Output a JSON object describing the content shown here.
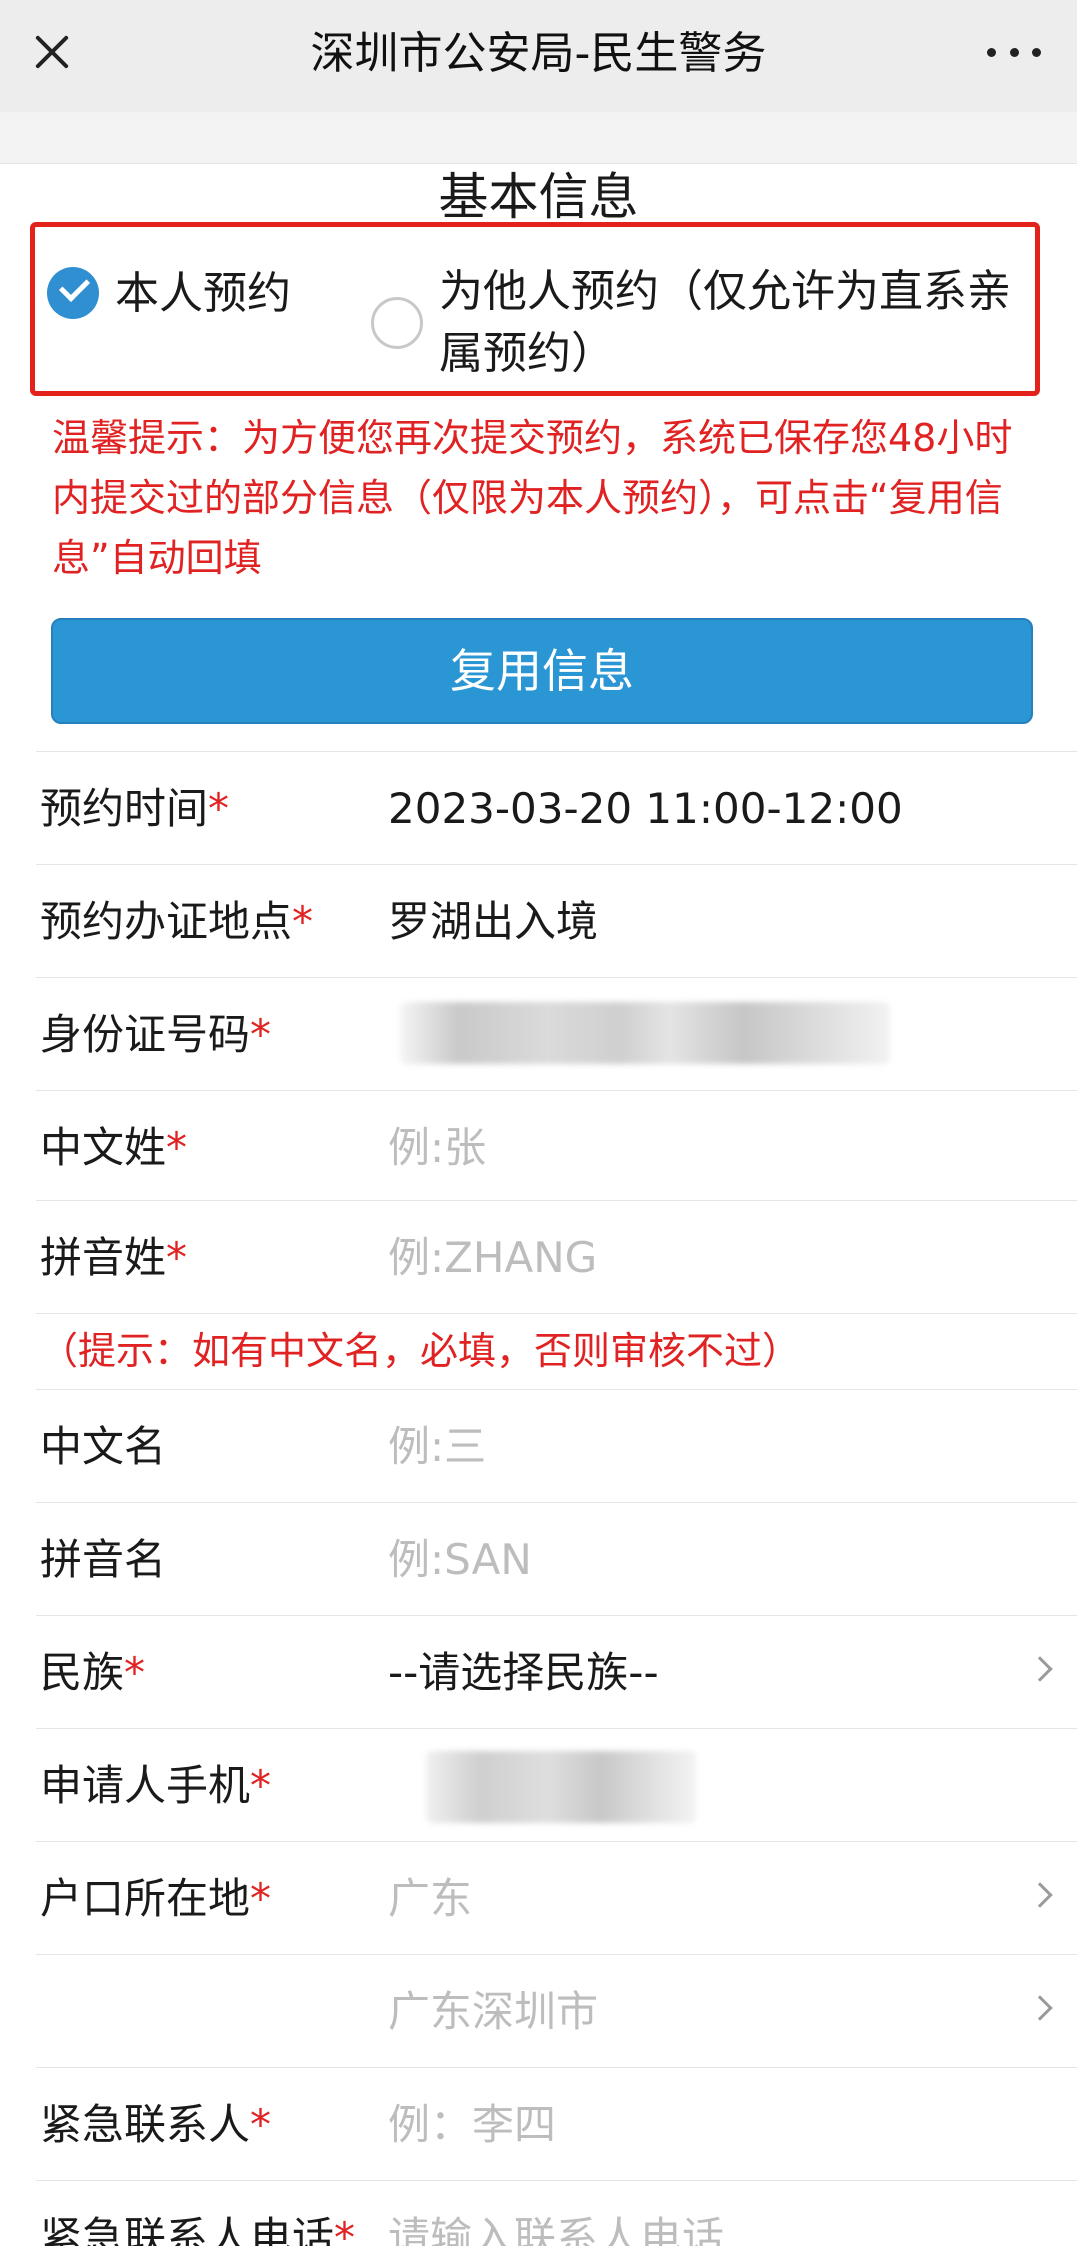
{
  "header": {
    "title": "深圳市公安局-民生警务"
  },
  "section_title": "基本信息",
  "booking_type": {
    "self_label": "本人预约",
    "other_label": "为他人预约（仅允许为直系亲属预约）",
    "selected": "self"
  },
  "tip_text": "温馨提示：为方便您再次提交预约，系统已保存您48小时内提交过的部分信息（仅限为本人预约），可点击“复用信息”自动回填",
  "reuse_button_label": "复用信息",
  "required_mark": "*",
  "fields": {
    "appointment_time": {
      "label": "预约时间",
      "value": "2023-03-20 11:00-12:00"
    },
    "location": {
      "label": "预约办证地点",
      "value": "罗湖出入境"
    },
    "id_number": {
      "label": "身份证号码"
    },
    "cn_surname": {
      "label": "中文姓",
      "placeholder": "例:张"
    },
    "py_surname": {
      "label": "拼音姓",
      "placeholder": "例:ZHANG"
    },
    "cn_name": {
      "label": "中文名",
      "placeholder": "例:三"
    },
    "py_name": {
      "label": "拼音名",
      "placeholder": "例:SAN"
    },
    "ethnicity": {
      "label": "民族",
      "value": "--请选择民族--"
    },
    "phone": {
      "label": "申请人手机"
    },
    "hukou": {
      "label": "户口所在地",
      "province": "广东",
      "city": "广东深圳市"
    },
    "emergency_contact": {
      "label": "紧急联系人",
      "placeholder": "例：李四"
    },
    "emergency_phone": {
      "label": "紧急联系人电话",
      "placeholder": "请输入联系人电话"
    }
  },
  "name_hint": "（提示：如有中文名，必填，否则审核不过）"
}
